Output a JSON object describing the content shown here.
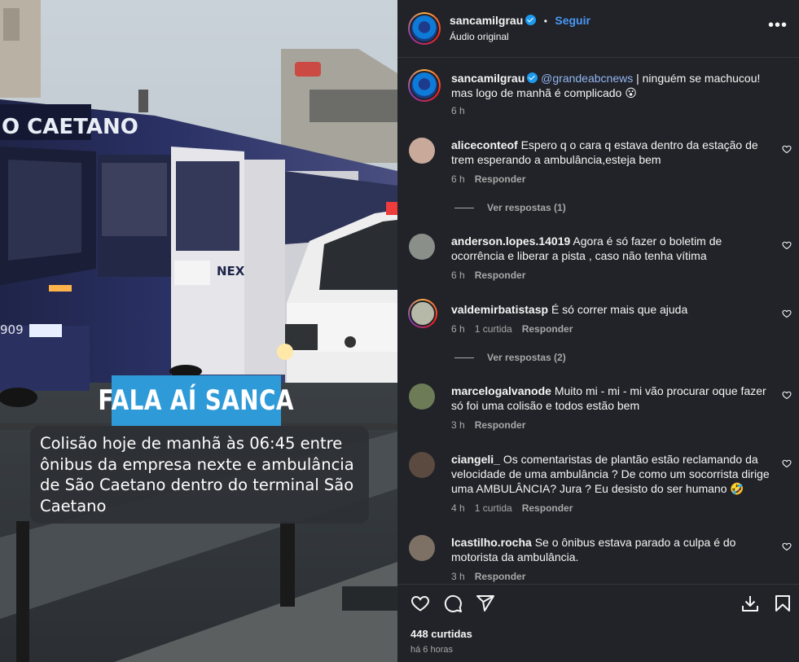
{
  "post": {
    "author": "sancamilgrau",
    "follow_label": "Seguir",
    "dot": "•",
    "audio": "Áudio original",
    "caption_mention": "@grandeabcnews",
    "caption_text": " | ninguém se machucou! mas logo de manhã é complicado 😮",
    "caption_time": "6 h"
  },
  "media": {
    "title_tag": "FALA AÍ SANCA",
    "caption": "Colisão hoje de manhã às 06:45 entre ônibus da empresa nexte e ambulância de São Caetano dentro do terminal São Caetano",
    "bus_sign": "O CAETANO",
    "bus_number": "909",
    "bus_brand": "NEXT"
  },
  "comments": [
    {
      "user": "aliceconteof",
      "text": "Espero q o cara q estava dentro da estação de trem esperando a ambulância,esteja bem",
      "time": "6 h",
      "likes": "",
      "reply": "Responder",
      "view_replies": "Ver respostas (1)",
      "avatar_color": "#c9a99a"
    },
    {
      "user": "anderson.lopes.14019",
      "text": "Agora é só fazer o boletim de ocorrência e liberar a pista , caso não tenha vítima",
      "time": "6 h",
      "likes": "",
      "reply": "Responder",
      "view_replies": "",
      "avatar_color": "#8a8f8a"
    },
    {
      "user": "valdemirbatistasp",
      "text": "É só correr mais que ajuda",
      "time": "6 h",
      "likes": "1 curtida",
      "reply": "Responder",
      "view_replies": "Ver respostas (2)",
      "avatar_color": "#b7b9a8"
    },
    {
      "user": "marcelogalvanode",
      "text": "Muito mi - mi - mi vão procurar oque fazer só foi uma colisão e todos estão bem",
      "time": "3 h",
      "likes": "",
      "reply": "Responder",
      "view_replies": "",
      "avatar_color": "#6d7b57"
    },
    {
      "user": "ciangeli_",
      "text": "Os comentaristas de plantão estão reclamando da velocidade de uma ambulância ? De como um socorrista dirige uma AMBULÂNCIA? Jura ? Eu desisto do ser humano 🤣",
      "time": "4 h",
      "likes": "1 curtida",
      "reply": "Responder",
      "view_replies": "",
      "avatar_color": "#5a4a40"
    },
    {
      "user": "lcastilho.rocha",
      "text": "Se o ônibus estava parado a culpa é do motorista da ambulância.",
      "time": "3 h",
      "likes": "",
      "reply": "Responder",
      "view_replies": "",
      "avatar_color": "#7d7166"
    }
  ],
  "actions": {
    "like_count": "448 curtidas",
    "posted": "há 6 horas",
    "icons": [
      "heart-icon",
      "comment-icon",
      "share-icon",
      "download-icon",
      "bookmark-icon"
    ]
  },
  "colors": {
    "panel": "#212328",
    "link": "#4a98f5",
    "verified": "#1d9bf0",
    "tag": "#2f9ad8"
  }
}
